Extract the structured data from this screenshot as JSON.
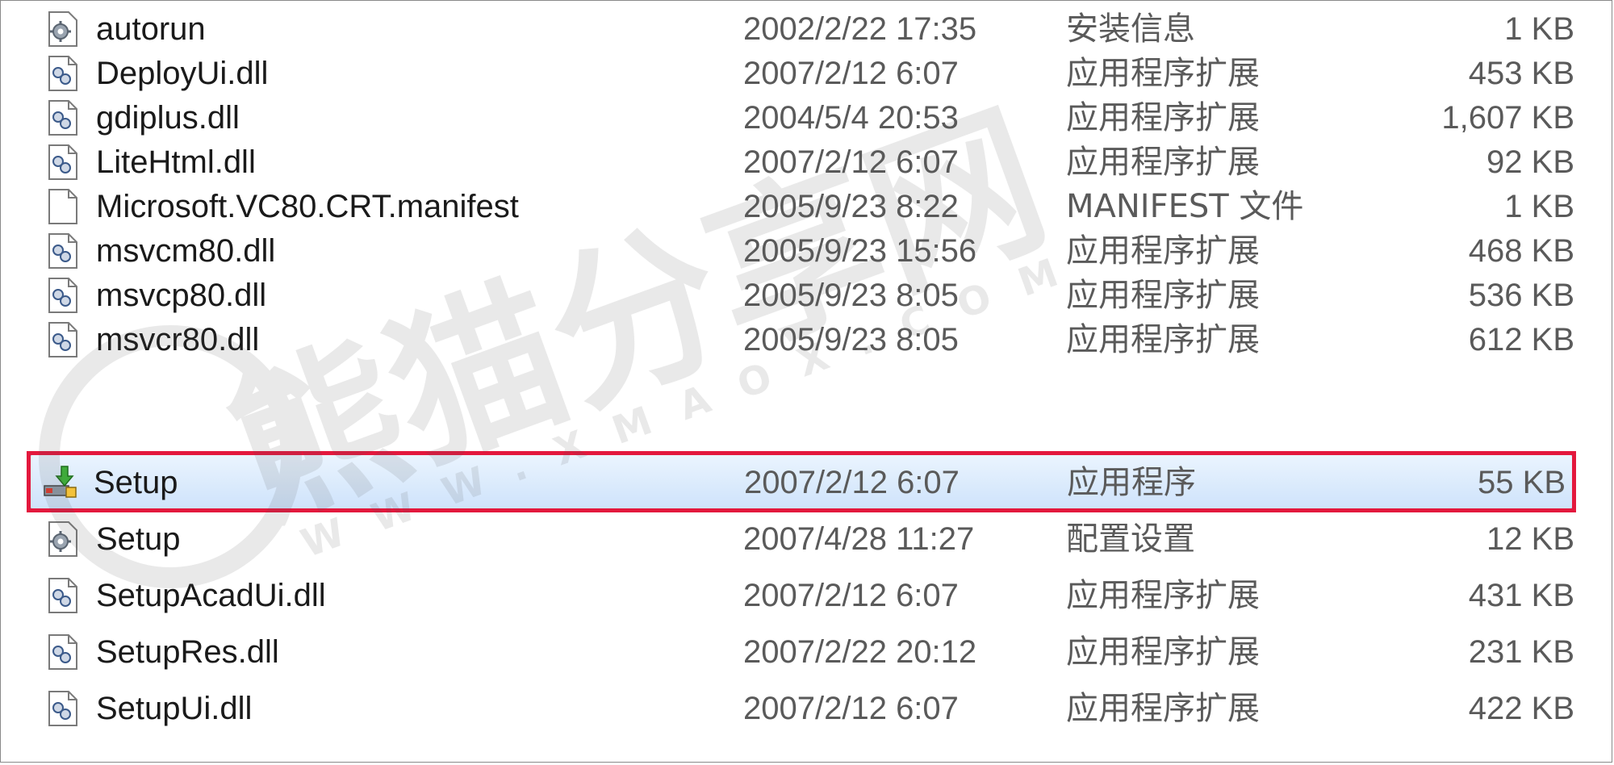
{
  "files": [
    {
      "name": "autorun",
      "date": "2002/2/22 17:35",
      "type": "安装信息",
      "size": "1 KB",
      "icon": "settings-file-icon"
    },
    {
      "name": "DeployUi.dll",
      "date": "2007/2/12 6:07",
      "type": "应用程序扩展",
      "size": "453 KB",
      "icon": "dll-file-icon"
    },
    {
      "name": "gdiplus.dll",
      "date": "2004/5/4 20:53",
      "type": "应用程序扩展",
      "size": "1,607 KB",
      "icon": "dll-file-icon"
    },
    {
      "name": "LiteHtml.dll",
      "date": "2007/2/12 6:07",
      "type": "应用程序扩展",
      "size": "92 KB",
      "icon": "dll-file-icon"
    },
    {
      "name": "Microsoft.VC80.CRT.manifest",
      "date": "2005/9/23 8:22",
      "type": "MANIFEST 文件",
      "size": "1 KB",
      "icon": "blank-file-icon"
    },
    {
      "name": "msvcm80.dll",
      "date": "2005/9/23 15:56",
      "type": "应用程序扩展",
      "size": "468 KB",
      "icon": "dll-file-icon"
    },
    {
      "name": "msvcp80.dll",
      "date": "2005/9/23 8:05",
      "type": "应用程序扩展",
      "size": "536 KB",
      "icon": "dll-file-icon"
    },
    {
      "name": "msvcr80.dll",
      "date": "2005/9/23 8:05",
      "type": "应用程序扩展",
      "size": "612 KB",
      "icon": "dll-file-icon"
    },
    {
      "name": "Setup",
      "date": "2007/2/12 6:07",
      "type": "应用程序",
      "size": "55 KB",
      "icon": "setup-installer-icon",
      "selected": true
    },
    {
      "name": "Setup",
      "date": "2007/4/28 11:27",
      "type": "配置设置",
      "size": "12 KB",
      "icon": "settings-file-icon"
    },
    {
      "name": "SetupAcadUi.dll",
      "date": "2007/2/12 6:07",
      "type": "应用程序扩展",
      "size": "431 KB",
      "icon": "dll-file-icon"
    },
    {
      "name": "SetupRes.dll",
      "date": "2007/2/22 20:12",
      "type": "应用程序扩展",
      "size": "231 KB",
      "icon": "dll-file-icon"
    },
    {
      "name": "SetupUi.dll",
      "date": "2007/2/12 6:07",
      "type": "应用程序扩展",
      "size": "422 KB",
      "icon": "dll-file-icon"
    }
  ],
  "watermark": {
    "brand": "熊猫分享网",
    "url": "WWW.XMAOX.COM"
  },
  "colors": {
    "highlight_border": "#e3183d",
    "selection_top": "#eaf4fe",
    "selection_bottom": "#cfe3fb"
  }
}
